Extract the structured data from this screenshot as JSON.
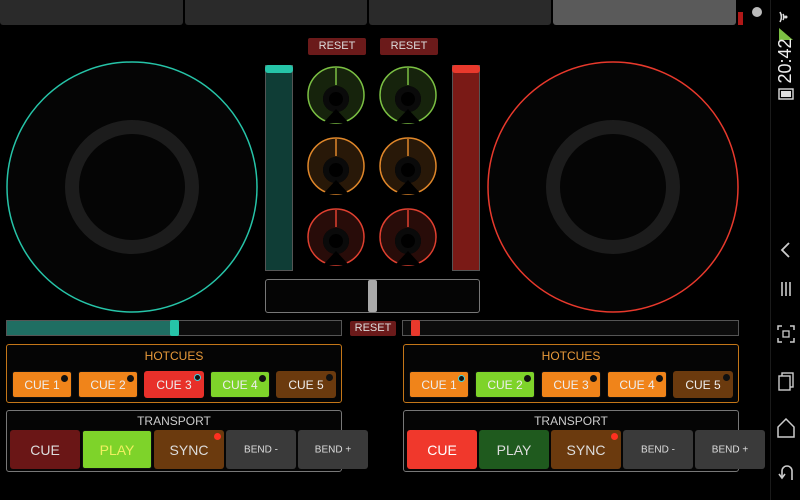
{
  "colors": {
    "deck_a": "#26c4a8",
    "deck_b": "#e8392c",
    "reset_bg": "#6b1a1a",
    "knob_green": "#7bc043",
    "knob_orange": "#e0872a",
    "knob_red": "#e04030"
  },
  "mixer": {
    "reset_left_label": "RESET",
    "reset_right_label": "RESET",
    "channel_a_level": 1.0,
    "channel_b_level": 1.0,
    "crossfader_position": 0.5
  },
  "pitch": {
    "reset_label": "RESET",
    "deck_a_value": 0.5,
    "deck_b_value": 0.0
  },
  "deck_a": {
    "hotcues_title": "HOTCUES",
    "transport_title": "TRANSPORT",
    "cues": [
      {
        "label": "CUE 1",
        "color": "#f0841a",
        "indicator": "off"
      },
      {
        "label": "CUE 2",
        "color": "#f0841a",
        "indicator": "off"
      },
      {
        "label": "CUE 3",
        "color": "#e8302a",
        "indicator": "on"
      },
      {
        "label": "CUE 4",
        "color": "#7ed32a",
        "indicator": "off"
      },
      {
        "label": "CUE 5",
        "color": "#6b3a0e",
        "indicator": "off"
      }
    ],
    "transport": [
      {
        "label": "CUE",
        "color": "#6a1616",
        "text_color": "#dddddd",
        "size": "big"
      },
      {
        "label": "PLAY",
        "color": "#7ed32a",
        "text_color": "#f0f060",
        "size": "big"
      },
      {
        "label": "SYNC",
        "color": "#6b3a0e",
        "text_color": "#dddddd",
        "size": "big",
        "indicator": "red"
      },
      {
        "label": "BEND -",
        "color": "#3a3a3a",
        "text_color": "#dddddd",
        "size": "small"
      },
      {
        "label": "BEND +",
        "color": "#3a3a3a",
        "text_color": "#dddddd",
        "size": "small"
      }
    ]
  },
  "deck_b": {
    "hotcues_title": "HOTCUES",
    "transport_title": "TRANSPORT",
    "cues": [
      {
        "label": "CUE 1",
        "color": "#f0841a",
        "indicator": "on"
      },
      {
        "label": "CUE 2",
        "color": "#7ed32a",
        "indicator": "off"
      },
      {
        "label": "CUE 3",
        "color": "#f0841a",
        "indicator": "off"
      },
      {
        "label": "CUE 4",
        "color": "#f0841a",
        "indicator": "off"
      },
      {
        "label": "CUE 5",
        "color": "#6b3a0e",
        "indicator": "off"
      }
    ],
    "transport": [
      {
        "label": "CUE",
        "color": "#f0382c",
        "text_color": "#ffffff",
        "size": "big"
      },
      {
        "label": "PLAY",
        "color": "#1f5a1e",
        "text_color": "#dddddd",
        "size": "big"
      },
      {
        "label": "SYNC",
        "color": "#6b3a0e",
        "text_color": "#dddddd",
        "size": "big",
        "indicator": "red"
      },
      {
        "label": "BEND -",
        "color": "#3a3a3a",
        "text_color": "#dddddd",
        "size": "small"
      },
      {
        "label": "BEND +",
        "color": "#3a3a3a",
        "text_color": "#dddddd",
        "size": "small"
      }
    ]
  },
  "status_bar": {
    "time": "20:42"
  }
}
